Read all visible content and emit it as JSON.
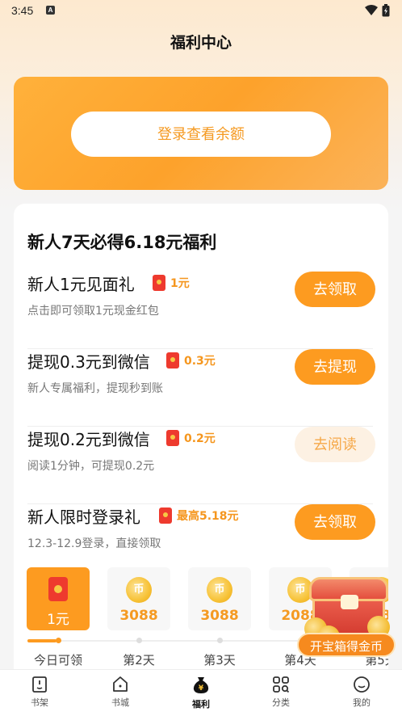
{
  "status_bar": {
    "time": "3:45",
    "notif_badge": "A"
  },
  "header": {
    "title": "福利中心"
  },
  "login": {
    "button_label": "登录查看余额"
  },
  "welfare": {
    "title": "新人7天必得6.18元福利",
    "tasks": [
      {
        "title": "新人1元见面礼",
        "reward": "1元",
        "desc": "点击即可领取1元现金红包",
        "button": "去领取",
        "enabled": true
      },
      {
        "title": "提现0.3元到微信",
        "reward": "0.3元",
        "desc": "新人专属福利，提现秒到账",
        "button": "去提现",
        "enabled": true
      },
      {
        "title": "提现0.2元到微信",
        "reward": "0.2元",
        "desc": "阅读1分钟，可提现0.2元",
        "button": "去阅读",
        "enabled": false
      },
      {
        "title": "新人限时登录礼",
        "reward": "最高5.18元",
        "desc": "12.3-12.9登录，直接领取",
        "button": "去领取",
        "enabled": true
      }
    ],
    "days": [
      {
        "amount": "1元",
        "label": "今日可领",
        "type": "cash",
        "active": true
      },
      {
        "amount": "3088",
        "label": "第2天",
        "type": "coin",
        "active": false
      },
      {
        "amount": "3088",
        "label": "第3天",
        "type": "coin",
        "active": false
      },
      {
        "amount": "2088",
        "label": "第4天",
        "type": "coin",
        "active": false
      },
      {
        "amount": "3088",
        "label": "第5天",
        "type": "coin",
        "active": false
      }
    ],
    "coin_glyph": "币"
  },
  "treasure": {
    "label": "开宝箱得金币"
  },
  "nav": {
    "items": [
      {
        "label": "书架",
        "icon": "bookshelf-icon"
      },
      {
        "label": "书城",
        "icon": "home-icon"
      },
      {
        "label": "福利",
        "icon": "money-bag-icon",
        "active": true
      },
      {
        "label": "分类",
        "icon": "category-icon"
      },
      {
        "label": "我的",
        "icon": "profile-icon"
      }
    ]
  },
  "colors": {
    "accent": "#fd9b20",
    "reward": "#f5961e",
    "envelope": "#ee3a2e"
  }
}
